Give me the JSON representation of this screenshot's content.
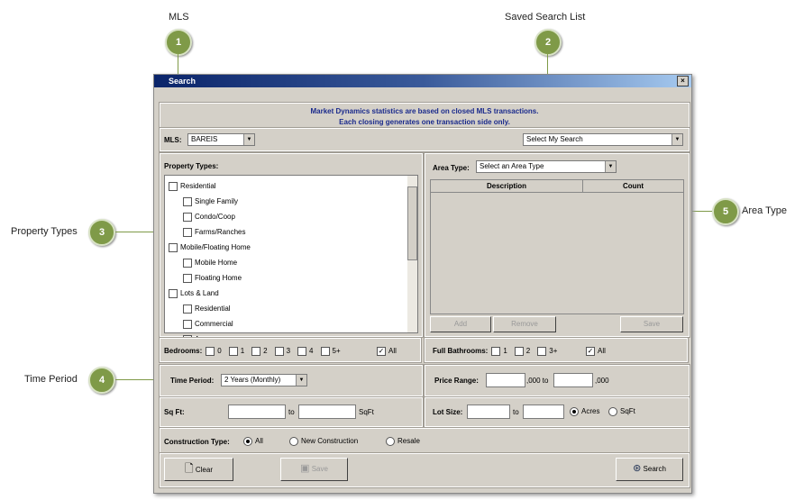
{
  "callouts": [
    {
      "num": "1",
      "label": "MLS"
    },
    {
      "num": "2",
      "label": "Saved Search List"
    },
    {
      "num": "3",
      "label": "Property Types"
    },
    {
      "num": "4",
      "label": "Time Period"
    },
    {
      "num": "5",
      "label": "Area Type"
    }
  ],
  "window": {
    "title": "Search",
    "close": "×"
  },
  "notice": {
    "line1": "Market Dynamics statistics are based on closed MLS transactions.",
    "line2": "Each closing generates one transaction side only."
  },
  "mls": {
    "label": "MLS:",
    "value": "BAREIS"
  },
  "saved_search": {
    "value": "Select My Search"
  },
  "property_types": {
    "label": "Property Types:",
    "items": [
      {
        "label": "Residential",
        "indent": 0
      },
      {
        "label": "Single Family",
        "indent": 1
      },
      {
        "label": "Condo/Coop",
        "indent": 1
      },
      {
        "label": "Farms/Ranches",
        "indent": 1
      },
      {
        "label": "Mobile/Floating Home",
        "indent": 0
      },
      {
        "label": "Mobile Home",
        "indent": 1
      },
      {
        "label": "Floating Home",
        "indent": 1
      },
      {
        "label": "Lots & Land",
        "indent": 0
      },
      {
        "label": "Residential",
        "indent": 1
      },
      {
        "label": "Commercial",
        "indent": 1
      },
      {
        "label": "Acreage",
        "indent": 1
      }
    ]
  },
  "area": {
    "label": "Area Type:",
    "value": "Select an Area Type",
    "columns": [
      "Description",
      "Count"
    ],
    "add": "Add",
    "remove": "Remove",
    "save": "Save"
  },
  "bedrooms": {
    "label": "Bedrooms:",
    "options": [
      "0",
      "1",
      "2",
      "3",
      "4",
      "5+"
    ],
    "all": "All",
    "all_checked": true
  },
  "bathrooms": {
    "label": "Full Bathrooms:",
    "options": [
      "1",
      "2",
      "3+"
    ],
    "all": "All",
    "all_checked": true
  },
  "time_period": {
    "label": "Time Period:",
    "value": "2 Years (Monthly)"
  },
  "price_range": {
    "label": "Price Range:",
    "mid": ",000 to",
    "end": ",000",
    "min": "",
    "max": ""
  },
  "sqft": {
    "label": "Sq Ft:",
    "to": "to",
    "unit": "SqFt"
  },
  "lot_size": {
    "label": "Lot Size:",
    "to": "to",
    "acres": "Acres",
    "sqft": "SqFt",
    "selected": "Acres"
  },
  "construction": {
    "label": "Construction Type:",
    "options": [
      "All",
      "New Construction",
      "Resale"
    ],
    "selected": "All"
  },
  "buttons": {
    "clear": "Clear",
    "save": "Save",
    "search": "Search"
  }
}
